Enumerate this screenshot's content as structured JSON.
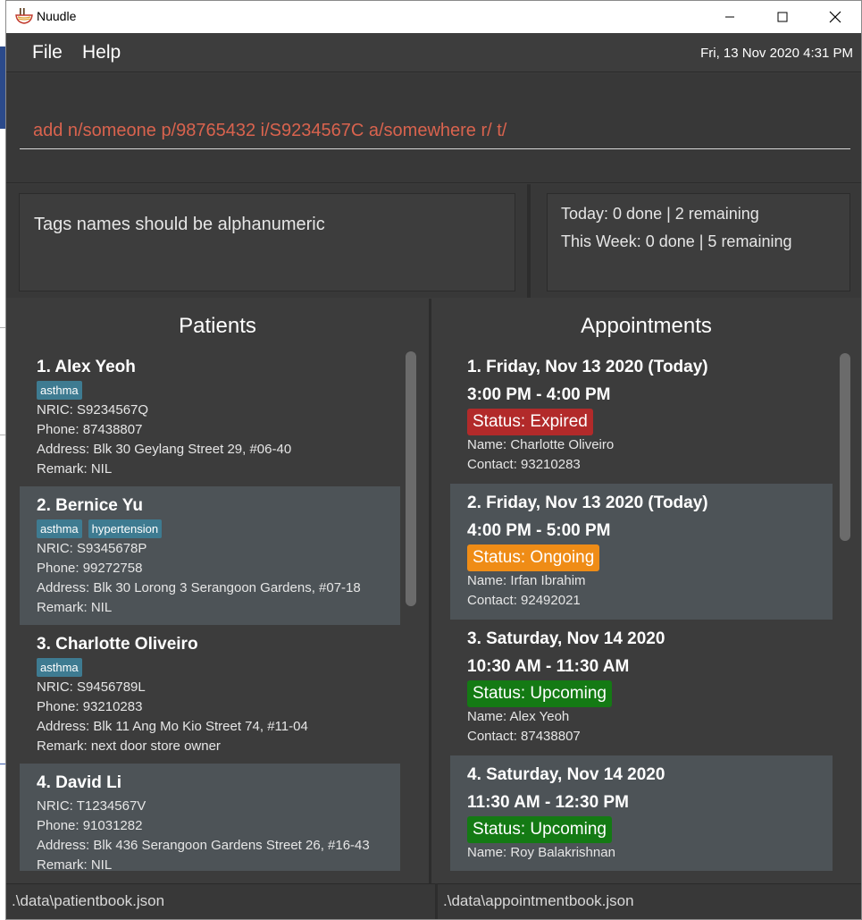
{
  "window": {
    "title": "Nuudle",
    "controls": {
      "minimize": "minimize",
      "maximize": "maximize",
      "close": "close"
    }
  },
  "menu": {
    "file": "File",
    "help": "Help"
  },
  "datetime": "Fri, 13 Nov 2020 4:31 PM",
  "command": {
    "value": "add n/someone p/98765432 i/S9234567C a/somewhere r/ t/"
  },
  "result": {
    "message": "Tags names should be alphanumeric"
  },
  "stats": {
    "today": "Today: 0 done | 2 remaining",
    "week": "This Week: 0 done | 5 remaining"
  },
  "patients": {
    "title": "Patients",
    "items": [
      {
        "heading": "1.  Alex Yeoh",
        "tags": [
          "asthma"
        ],
        "nric": "NRIC: S9234567Q",
        "phone": "Phone: 87438807",
        "address": "Address: Blk 30 Geylang Street 29, #06-40",
        "remark": "Remark: NIL"
      },
      {
        "heading": "2.  Bernice Yu",
        "tags": [
          "asthma",
          "hypertension"
        ],
        "nric": "NRIC: S9345678P",
        "phone": "Phone: 99272758",
        "address": "Address: Blk 30 Lorong 3 Serangoon Gardens, #07-18",
        "remark": "Remark: NIL"
      },
      {
        "heading": "3.  Charlotte Oliveiro",
        "tags": [
          "asthma"
        ],
        "nric": "NRIC: S9456789L",
        "phone": "Phone: 93210283",
        "address": "Address: Blk 11 Ang Mo Kio Street 74, #11-04",
        "remark": "Remark: next door store owner"
      },
      {
        "heading": "4.  David Li",
        "tags": [],
        "nric": "NRIC: T1234567V",
        "phone": "Phone: 91031282",
        "address": "Address: Blk 436 Serangoon Gardens Street 26, #16-43",
        "remark": "Remark: NIL"
      }
    ]
  },
  "appointments": {
    "title": "Appointments",
    "items": [
      {
        "heading": "1.  Friday, Nov 13 2020 (Today)",
        "time": "3:00 PM - 4:00 PM",
        "status": "Status: Expired",
        "status_kind": "expired",
        "name": "Name: Charlotte Oliveiro",
        "contact": "Contact: 93210283"
      },
      {
        "heading": "2.  Friday, Nov 13 2020 (Today)",
        "time": "4:00 PM - 5:00 PM",
        "status": "Status: Ongoing",
        "status_kind": "ongoing",
        "name": "Name: Irfan Ibrahim",
        "contact": "Contact: 92492021"
      },
      {
        "heading": "3.  Saturday, Nov 14 2020",
        "time": "10:30 AM - 11:30 AM",
        "status": "Status: Upcoming",
        "status_kind": "upcoming",
        "name": "Name: Alex Yeoh",
        "contact": "Contact: 87438807"
      },
      {
        "heading": "4.  Saturday, Nov 14 2020",
        "time": "11:30 AM - 12:30 PM",
        "status": "Status: Upcoming",
        "status_kind": "upcoming",
        "name": "Name: Roy Balakrishnan",
        "contact": ""
      }
    ]
  },
  "footer": {
    "patient_file": ".\\data\\patientbook.json",
    "appointment_file": ".\\data\\appointmentbook.json"
  },
  "colors": {
    "expired": "#b22a2a",
    "ongoing": "#ef8c16",
    "upcoming": "#147a14",
    "tag": "#3e7b91",
    "command_text": "#d9634e"
  }
}
